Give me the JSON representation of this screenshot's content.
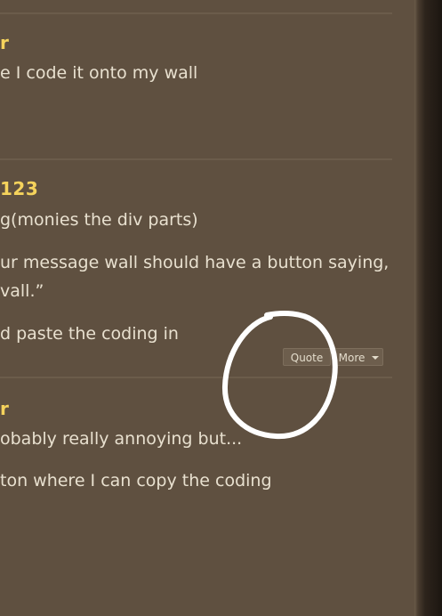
{
  "posts": [
    {
      "author": "r",
      "paragraphs": [
        "e I code it onto my wall"
      ]
    },
    {
      "author": "123",
      "paragraphs": [
        "g(monies the div parts)",
        "ur message wall should have a button saying,",
        "vall.”",
        "d paste the coding in"
      ],
      "actions": {
        "quote_label": "Quote",
        "more_label": "More"
      }
    },
    {
      "author": "r",
      "paragraphs": [
        "obably really annoying but...",
        "ton where I can copy the coding"
      ]
    }
  ],
  "colors": {
    "background": "#5f5040",
    "author": "#f5d35c",
    "text": "#e8e0cf",
    "annotation": "#ffffff"
  },
  "icons": {
    "more_caret": "chevron-down-icon"
  }
}
